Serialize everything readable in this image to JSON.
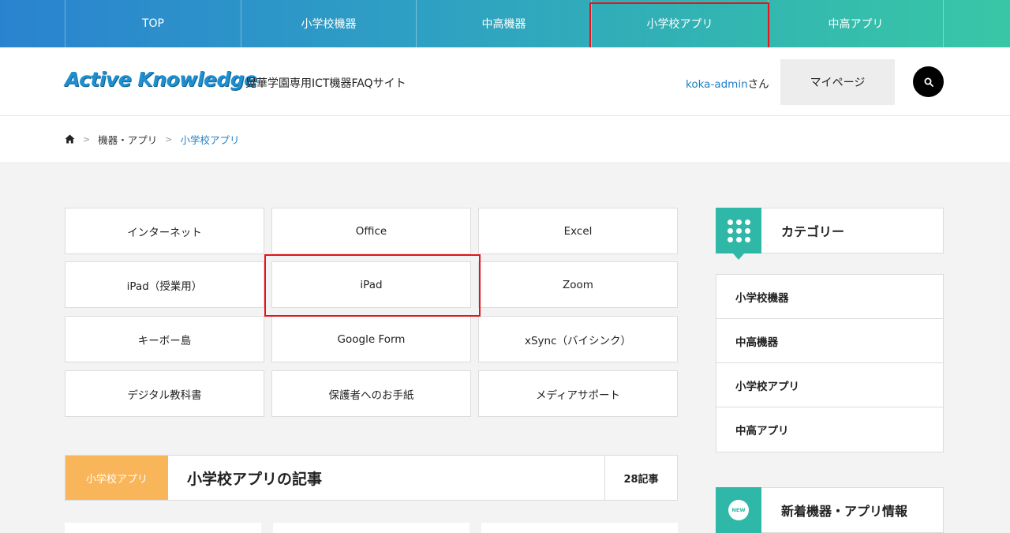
{
  "topnav": {
    "items": [
      {
        "label": "TOP"
      },
      {
        "label": "小学校機器"
      },
      {
        "label": "中高機器"
      },
      {
        "label": "小学校アプリ"
      },
      {
        "label": "中高アプリ"
      }
    ]
  },
  "header": {
    "logo": "Active Knowledge",
    "tagline": "晃華学園専用ICT機器FAQサイト",
    "user_name": "koka-admin",
    "user_suffix": "さん",
    "mypage_label": "マイページ",
    "search_icon": "search-icon"
  },
  "breadcrumb": {
    "home_icon": "home-icon",
    "items": [
      "機器・アプリ",
      "小学校アプリ"
    ]
  },
  "categories": [
    "インターネット",
    "Office",
    "Excel",
    "iPad（授業用）",
    "iPad",
    "Zoom",
    "キーボー島",
    "Google Form",
    "xSync（バイシンク）",
    "デジタル教科書",
    "保護者へのお手紙",
    "メディアサポート"
  ],
  "section": {
    "badge": "小学校アプリ",
    "title": "小学校アプリの記事",
    "count": "28記事"
  },
  "sidebar": {
    "category_title": "カテゴリー",
    "category_icon": "grid-icon",
    "items": [
      "小学校機器",
      "中高機器",
      "小学校アプリ",
      "中高アプリ"
    ],
    "news_title": "新着機器・アプリ情報",
    "news_icon": "new-badge-icon",
    "news_badge": "NEW"
  },
  "colors": {
    "accent_blue": "#1d7fc4",
    "teal": "#2fb7a7",
    "orange": "#f9b55a",
    "highlight_red": "#e3141b"
  }
}
